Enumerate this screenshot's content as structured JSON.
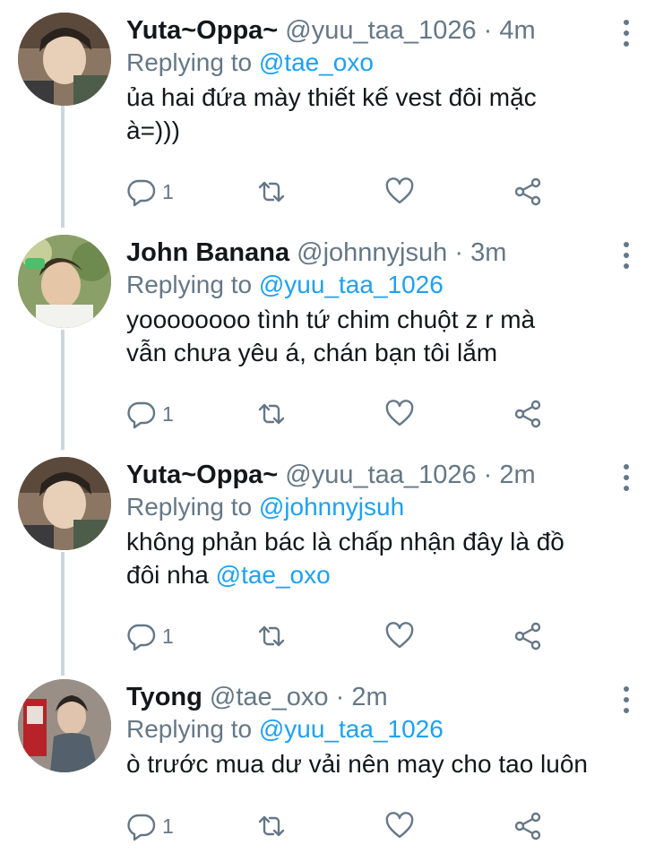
{
  "tweets": [
    {
      "name": "Yuta~Oppa~",
      "handle": "@yuu_taa_1026",
      "separator": "·",
      "time": "4m",
      "replying_prefix": "Replying to",
      "replying_to": "@tae_oxo",
      "text_parts": [
        "ủa hai đứa mày thiết kế vest đôi mặc",
        "à=)))"
      ],
      "mention_in_text": "",
      "reply_count": "1",
      "avatar_icon": "avatar-photo"
    },
    {
      "name": "John Banana",
      "handle": "@johnnyjsuh",
      "separator": "·",
      "time": "3m",
      "replying_prefix": "Replying to",
      "replying_to": "@yuu_taa_1026",
      "text_parts": [
        "yoooooooo tình tứ chim chuột z r mà",
        "vẫn chưa yêu á, chán bạn tôi lắm"
      ],
      "mention_in_text": "",
      "reply_count": "1",
      "avatar_icon": "avatar-photo"
    },
    {
      "name": "Yuta~Oppa~",
      "handle": "@yuu_taa_1026",
      "separator": "·",
      "time": "2m",
      "replying_prefix": "Replying to",
      "replying_to": "@johnnyjsuh",
      "text_parts": [
        "không phản bác là chấp nhận đây là đồ",
        "đôi nha "
      ],
      "mention_in_text": "@tae_oxo",
      "reply_count": "1",
      "avatar_icon": "avatar-photo"
    },
    {
      "name": "Tyong",
      "handle": "@tae_oxo",
      "separator": "·",
      "time": "2m",
      "replying_prefix": "Replying to",
      "replying_to": "@yuu_taa_1026",
      "text_parts": [
        "ò trước mua dư vải nên may cho tao luôn"
      ],
      "mention_in_text": "",
      "reply_count": "1",
      "avatar_icon": "avatar-photo"
    }
  ],
  "icons": {
    "reply": "reply-icon",
    "retweet": "retweet-icon",
    "like": "like-icon",
    "share": "share-icon",
    "more": "more-icon"
  },
  "colors": {
    "link": "#1da1f2",
    "secondary": "#657786",
    "thread_line": "#ccd6dd"
  }
}
